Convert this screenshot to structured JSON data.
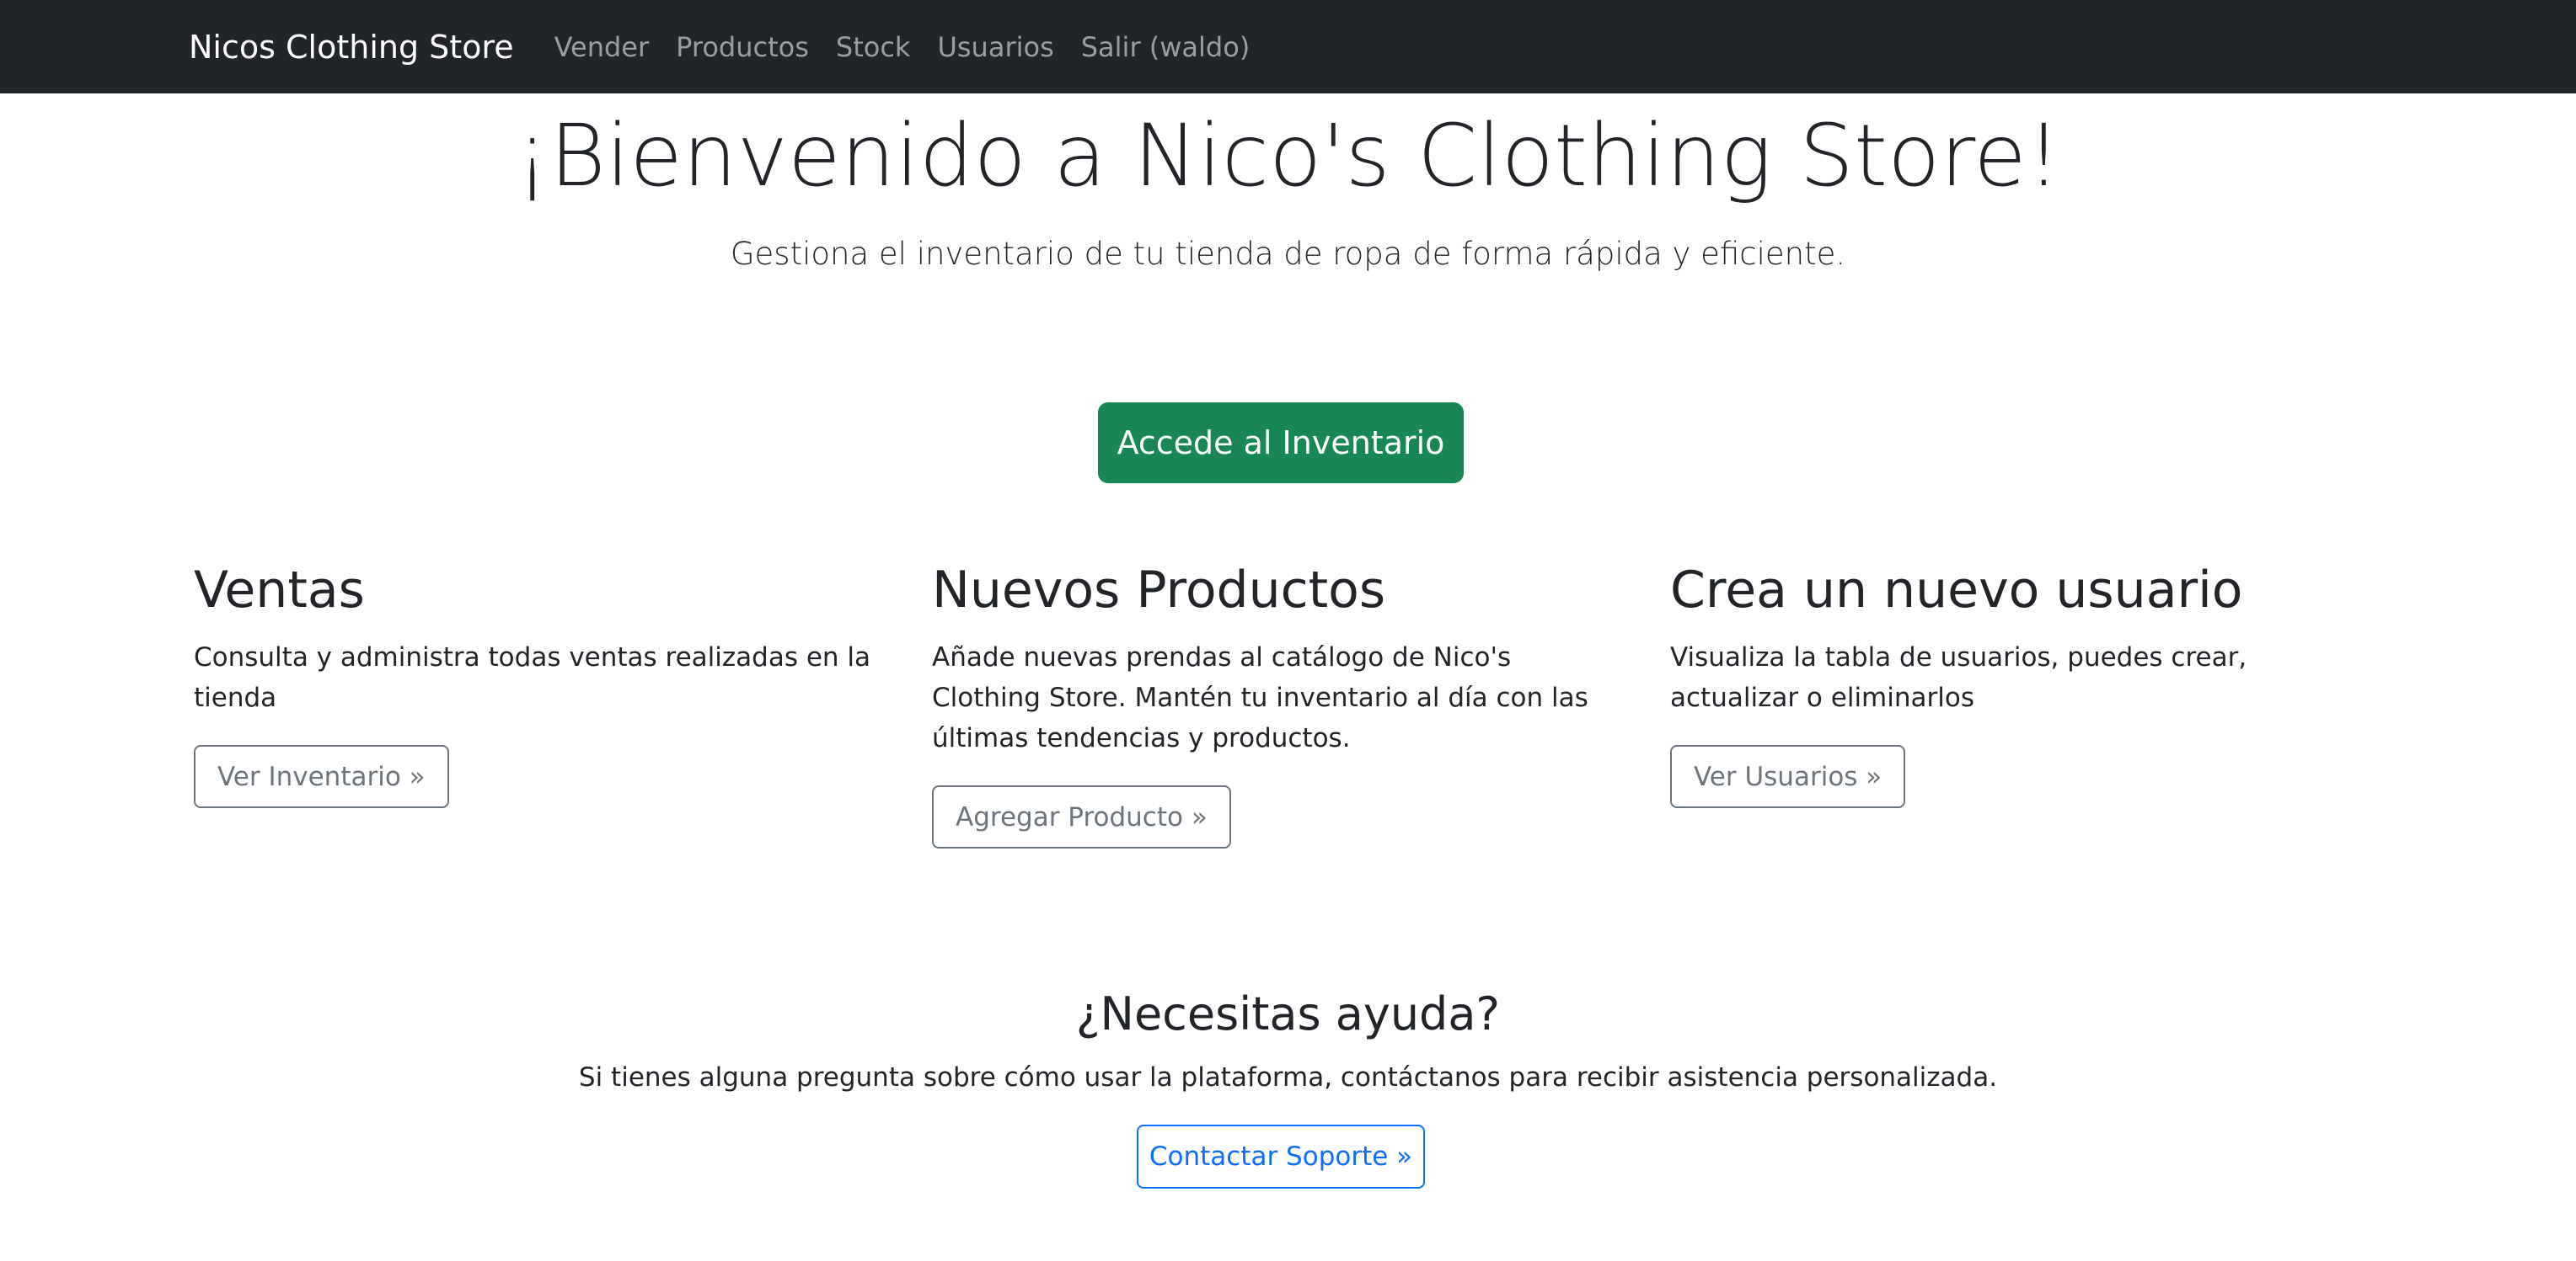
{
  "navbar": {
    "brand": "Nicos Clothing Store",
    "links": [
      "Vender",
      "Productos",
      "Stock",
      "Usuarios",
      "Salir (waldo)"
    ]
  },
  "hero": {
    "title": "¡Bienvenido a Nico's Clothing Store!",
    "lead": "Gestiona el inventario de tu tienda de ropa de forma rápida y eficiente.",
    "button": "Accede al Inventario"
  },
  "features": [
    {
      "title": "Ventas",
      "text": "Consulta y administra todas ventas realizadas en la tienda",
      "button": "Ver Inventario »"
    },
    {
      "title": "Nuevos Productos",
      "text": "Añade nuevas prendas al catálogo de Nico's Clothing Store. Mantén tu inventario al día con las últimas tendencias y productos.",
      "button": "Agregar Producto »"
    },
    {
      "title": "Crea un nuevo usuario",
      "text": "Visualiza la tabla de usuarios, puedes crear, actualizar o eliminarlos",
      "button": "Ver Usuarios »"
    }
  ],
  "help": {
    "title": "¿Necesitas ayuda?",
    "text": "Si tienes alguna pregunta sobre cómo usar la plataforma, contáctanos para recibir asistencia personalizada.",
    "button": "Contactar Soporte »"
  },
  "colors": {
    "navbar_bg": "#212529",
    "success": "#198754",
    "secondary": "#6c757d",
    "primary": "#0d6efd"
  }
}
